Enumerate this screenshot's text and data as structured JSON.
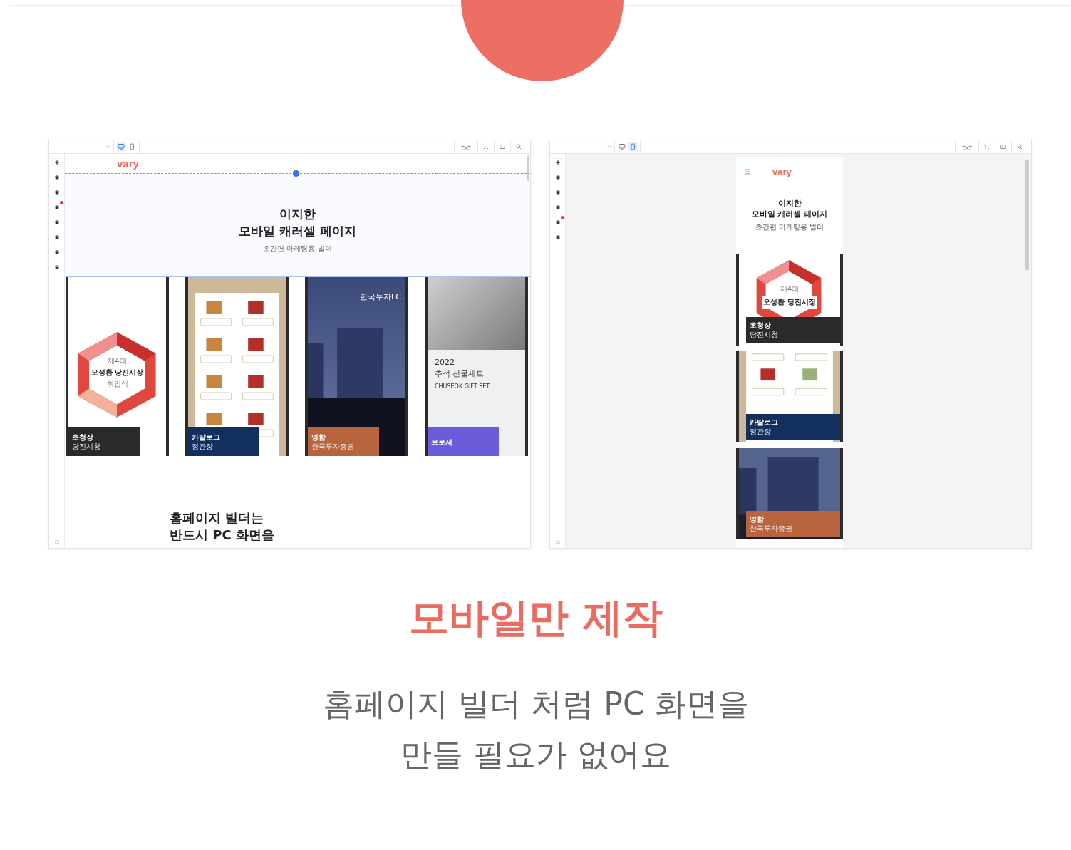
{
  "editors": [
    {
      "kind": "desktop",
      "device_tabs": [
        {
          "kind": "desktop",
          "selected": true
        },
        {
          "kind": "mobile",
          "selected": false
        }
      ],
      "rail_tools": [
        {
          "kind": "plus",
          "badge": false
        },
        {
          "kind": "page",
          "badge": false
        },
        {
          "kind": "text",
          "badge": false
        },
        {
          "kind": "grid",
          "badge": true
        },
        {
          "kind": "image",
          "badge": false
        },
        {
          "kind": "brush",
          "badge": false
        },
        {
          "kind": "box",
          "badge": false
        },
        {
          "kind": "lock",
          "badge": false
        }
      ],
      "logo": "vary",
      "hero": {
        "title_lines": [
          "이지한",
          "모바일 캐러셀 페이지"
        ],
        "subtitle": "초간편 마케팅용 빌더"
      },
      "cards": [
        {
          "kind": "invitation",
          "title": "초청장",
          "subtitle": "당진시청",
          "color": "#2a2a2a",
          "art_lines": [
            "제4대",
            "오성환 당진시장",
            "취임식"
          ]
        },
        {
          "kind": "catalog",
          "title": "카탈로그",
          "subtitle": "정관장",
          "color": "#12305e"
        },
        {
          "kind": "business-card",
          "title": "명함",
          "subtitle": "한국투자증권",
          "color": "#b8653f",
          "art_lines": [
            "한국투자FC"
          ]
        },
        {
          "kind": "brochure",
          "title": "브로셔",
          "color": "#6a5bd8",
          "art_lines": [
            "2022",
            "추석 선물세트",
            "CHUSEOK GIFT SET"
          ]
        }
      ],
      "section_text_lines": [
        "홈페이지 빌더는",
        "반드시 PC 화면을"
      ]
    },
    {
      "kind": "mobile",
      "device_tabs": [
        {
          "kind": "desktop",
          "selected": false
        },
        {
          "kind": "mobile",
          "selected": true
        }
      ],
      "rail_tools": [
        {
          "kind": "plus",
          "badge": false
        },
        {
          "kind": "page",
          "badge": false
        },
        {
          "kind": "image",
          "badge": false
        },
        {
          "kind": "wrench",
          "badge": false
        },
        {
          "kind": "eye",
          "badge": true
        },
        {
          "kind": "grid",
          "badge": false
        }
      ],
      "logo": "vary",
      "hero": {
        "title_lines": [
          "이지한",
          "모바일 캐러셀 페이지"
        ],
        "subtitle": "초간편 마케팅용 빌더"
      },
      "cards": [
        {
          "kind": "invitation",
          "title": "초청장",
          "subtitle": "당진시청",
          "color": "#2a2a2a",
          "art_lines": [
            "제4대",
            "오성환 당진시장"
          ]
        },
        {
          "kind": "catalog",
          "title": "카탈로그",
          "subtitle": "정관장",
          "color": "#12305e"
        },
        {
          "kind": "business-card",
          "title": "명함",
          "subtitle": "한국투자증권",
          "color": "#b8653f"
        }
      ]
    }
  ],
  "headline": "모바일만 제작",
  "description_lines": [
    "홈페이지 빌더 처럼 PC 화면을",
    "만들 필요가 없어요"
  ]
}
